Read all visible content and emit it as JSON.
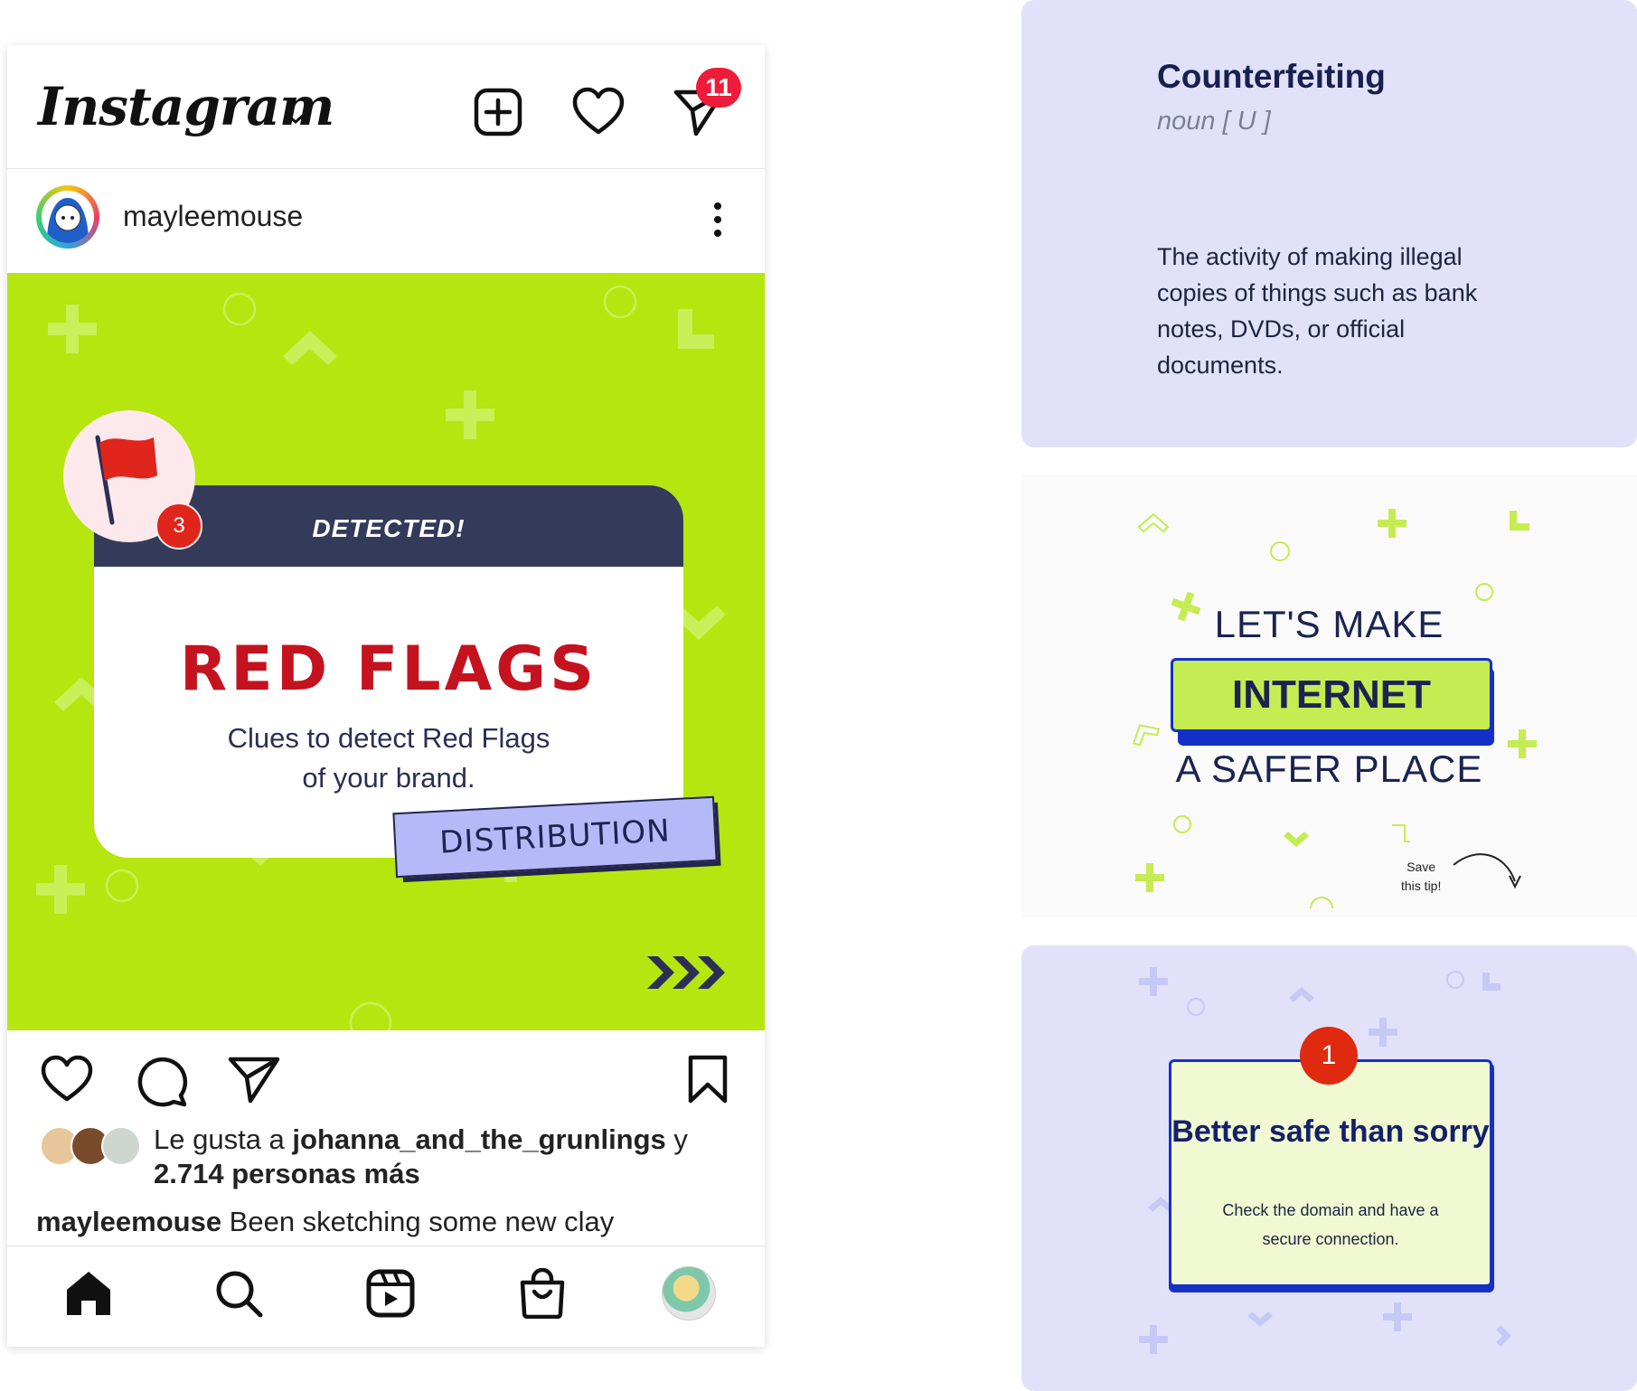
{
  "phone": {
    "header": {
      "logo": "Instagram",
      "message_badge": "11"
    },
    "post": {
      "username": "mayleemouse",
      "image": {
        "card_header": "DETECTED!",
        "title": "RED FLAGS",
        "subtitle_line1": "Clues to detect Red Flags",
        "subtitle_line2": "of your brand.",
        "tag": "DISTRIBUTION",
        "flag_count": "3"
      },
      "likes": {
        "prefix": "Le gusta a ",
        "user": "johanna_and_the_grunlings",
        "connector": " y",
        "others": "2.714 personas más"
      },
      "caption": {
        "user": "mayleemouse",
        "text": " Been sketching some new clay"
      }
    },
    "icons": [
      "chevron-down-icon",
      "new-post-icon",
      "heart-icon",
      "direct-message-icon",
      "more-options-icon",
      "like-icon",
      "comment-icon",
      "share-icon",
      "bookmark-icon",
      "home-icon",
      "search-icon",
      "reels-icon",
      "shop-icon"
    ]
  },
  "definition": {
    "word": "Counterfeiting",
    "part_of_speech": "noun [ U ]",
    "text": "The activity of making illegal copies of things such as bank notes, DVDs, or official documents."
  },
  "slogan": {
    "line1": "LET'S MAKE",
    "highlight": "INTERNET",
    "line3": "A SAFER PLACE",
    "save_line1": "Save",
    "save_line2": "this tip!"
  },
  "tip": {
    "number": "1",
    "title": "Better safe than sorry",
    "text": "Check the domain and have a secure connection."
  },
  "colors": {
    "lime": "#b5e60f",
    "navy": "#343a5a",
    "red": "#c4121e",
    "lavender": "#e1e2f9",
    "blue": "#1530c8"
  }
}
